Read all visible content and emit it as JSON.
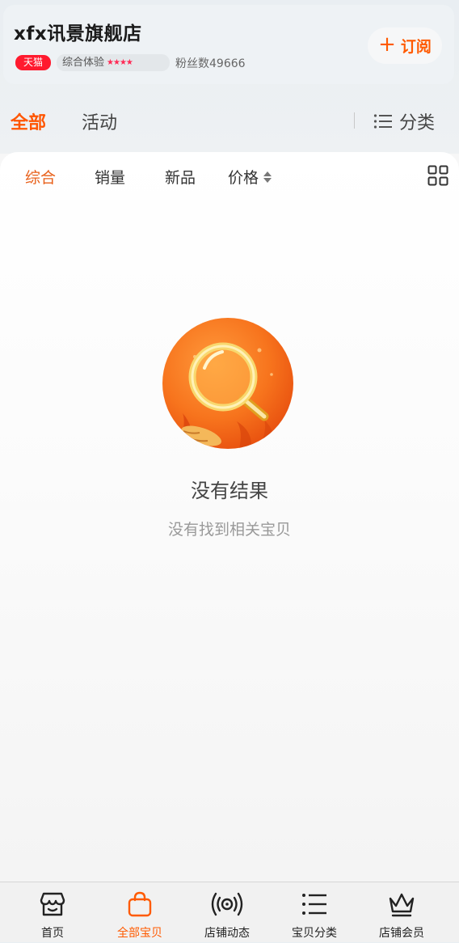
{
  "store": {
    "name": "xfx讯景旗舰店",
    "badge": "天猫",
    "rating_label": "综合体验",
    "rating_stars": "★★★★",
    "fans": "粉丝数49666",
    "subscribe_label": "订阅"
  },
  "top_tabs": {
    "all": "全部",
    "activity": "活动",
    "category": "分类"
  },
  "sort_bar": {
    "comprehensive": "综合",
    "sales": "销量",
    "new": "新品",
    "price": "价格"
  },
  "empty_state": {
    "title": "没有结果",
    "subtitle": "没有找到相关宝贝"
  },
  "bottom_nav": {
    "items": [
      {
        "label": "首页",
        "icon": "storefront-icon"
      },
      {
        "label": "全部宝贝",
        "icon": "shopping-bag-icon"
      },
      {
        "label": "店铺动态",
        "icon": "broadcast-icon"
      },
      {
        "label": "宝贝分类",
        "icon": "list-icon"
      },
      {
        "label": "店铺会员",
        "icon": "crown-icon"
      }
    ],
    "active_index": 1
  },
  "colors": {
    "accent": "#ff5500",
    "tmall_red": "#ff1a2e"
  }
}
